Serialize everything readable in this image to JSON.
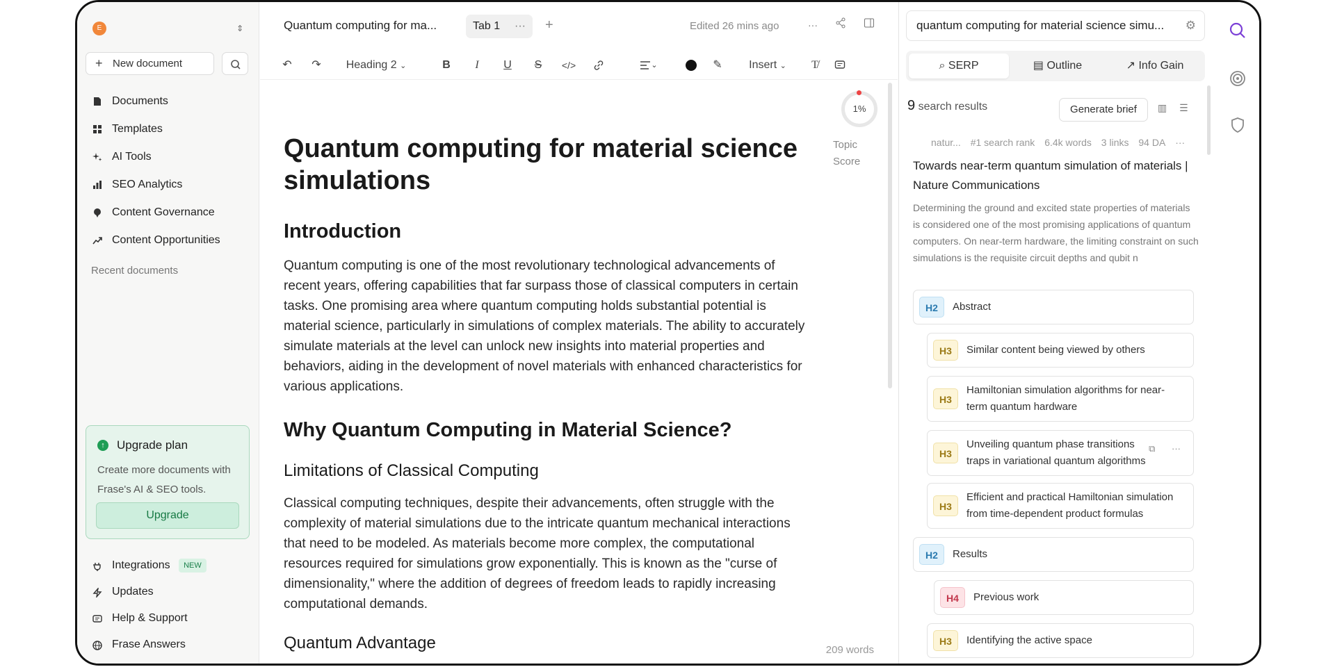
{
  "sidebar": {
    "workspace_initial": "E",
    "new_document": "New document",
    "items": [
      {
        "label": "Documents",
        "icon": "file-icon"
      },
      {
        "label": "Templates",
        "icon": "grid-icon"
      },
      {
        "label": "AI Tools",
        "icon": "sparkle-icon"
      },
      {
        "label": "SEO Analytics",
        "icon": "bar-chart-icon"
      },
      {
        "label": "Content Governance",
        "icon": "pin-icon"
      },
      {
        "label": "Content Opportunities",
        "icon": "trend-icon"
      }
    ],
    "recent_documents": "Recent documents",
    "upgrade": {
      "title": "Upgrade plan",
      "description": "Create more documents with Frase's AI & SEO tools.",
      "button": "Upgrade"
    },
    "bottom_items": [
      {
        "label": "Integrations",
        "badge": "NEW",
        "icon": "plug-icon"
      },
      {
        "label": "Updates",
        "icon": "bolt-icon"
      },
      {
        "label": "Help & Support",
        "icon": "chat-icon"
      },
      {
        "label": "Frase Answers",
        "icon": "globe-icon"
      }
    ]
  },
  "editor": {
    "doc_title_short": "Quantum computing for ma...",
    "tab": "Tab 1",
    "tab_more": "···",
    "tab_add": "+",
    "edited": "Edited 26 mins ago",
    "toolbar": {
      "heading": "Heading 2",
      "insert": "Insert"
    },
    "topic_score": {
      "value": "1%",
      "label": "Topic Score"
    },
    "word_count": "209 words",
    "title": "Quantum computing for material science simulations",
    "blocks": [
      {
        "type": "h2",
        "text": "Introduction"
      },
      {
        "type": "p",
        "text": "Quantum computing is one of the most revolutionary technological advancements of recent years, offering capabilities that far surpass those of classical computers in certain tasks. One promising area where quantum computing holds substantial potential is material science, particularly in simulations of complex materials. The ability to accurately simulate materials at the level can unlock new insights into material properties and behaviors, aiding in the development of novel materials with enhanced characteristics for various applications."
      },
      {
        "type": "h2",
        "text": "Why Quantum Computing in Material Science?"
      },
      {
        "type": "h3",
        "text": "Limitations of Classical Computing"
      },
      {
        "type": "p",
        "text": "Classical computing techniques, despite their advancements, often struggle with the complexity of material simulations due to the intricate quantum mechanical interactions that need to be modeled. As materials become more complex, the computational resources required for simulations grow exponentially. This is known as the \"curse of dimensionality,\" where the addition of degrees of freedom leads to rapidly increasing computational demands."
      },
      {
        "type": "h3",
        "text": "Quantum Advantage"
      }
    ]
  },
  "panel": {
    "query": "quantum computing for material science simu...",
    "tabs": [
      "SERP",
      "Outline",
      "Info Gain"
    ],
    "results_count": "9",
    "results_label": "search results",
    "generate_brief": "Generate brief",
    "result": {
      "source": "natur...",
      "rank": "#1 search rank",
      "words": "6.4k words",
      "links": "3 links",
      "da": "94 DA",
      "title": "Towards near-term quantum simulation of materials | Nature Communications",
      "description": "Determining the ground and excited state properties of materials is considered one of the most promising applications of quantum computers. On near-term hardware, the limiting constraint on such simulations is the requisite circuit depths and qubit n"
    },
    "outline": [
      {
        "tag": "H2",
        "text": "Abstract"
      },
      {
        "tag": "H3",
        "text": "Similar content being viewed by others"
      },
      {
        "tag": "H3",
        "text": "Hamiltonian simulation algorithms for near-term quantum hardware"
      },
      {
        "tag": "H3",
        "text": "Unveiling quantum phase transitions traps in variational quantum algorithms"
      },
      {
        "tag": "H3",
        "text": "Efficient and practical Hamiltonian simulation from time-dependent product formulas"
      },
      {
        "tag": "H2",
        "text": "Results"
      },
      {
        "tag": "H4",
        "text": "Previous work"
      },
      {
        "tag": "H3",
        "text": "Identifying the active space"
      }
    ]
  },
  "colors": {
    "accent": "#7b3fd6",
    "green": "#1f9d55"
  }
}
